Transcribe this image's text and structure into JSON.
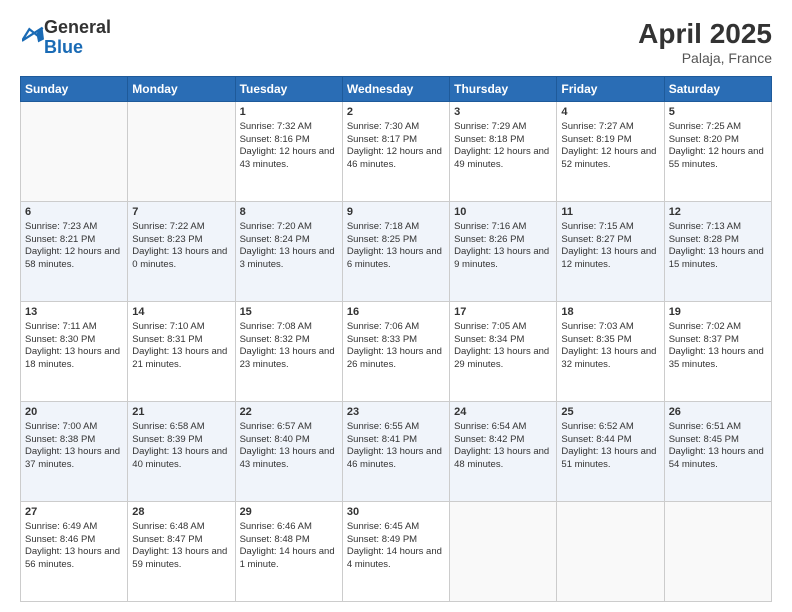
{
  "logo": {
    "general": "General",
    "blue": "Blue"
  },
  "title": {
    "main": "April 2025",
    "sub": "Palaja, France"
  },
  "headers": [
    "Sunday",
    "Monday",
    "Tuesday",
    "Wednesday",
    "Thursday",
    "Friday",
    "Saturday"
  ],
  "weeks": [
    [
      {
        "day": "",
        "info": ""
      },
      {
        "day": "",
        "info": ""
      },
      {
        "day": "1",
        "info": "Sunrise: 7:32 AM\nSunset: 8:16 PM\nDaylight: 12 hours and 43 minutes."
      },
      {
        "day": "2",
        "info": "Sunrise: 7:30 AM\nSunset: 8:17 PM\nDaylight: 12 hours and 46 minutes."
      },
      {
        "day": "3",
        "info": "Sunrise: 7:29 AM\nSunset: 8:18 PM\nDaylight: 12 hours and 49 minutes."
      },
      {
        "day": "4",
        "info": "Sunrise: 7:27 AM\nSunset: 8:19 PM\nDaylight: 12 hours and 52 minutes."
      },
      {
        "day": "5",
        "info": "Sunrise: 7:25 AM\nSunset: 8:20 PM\nDaylight: 12 hours and 55 minutes."
      }
    ],
    [
      {
        "day": "6",
        "info": "Sunrise: 7:23 AM\nSunset: 8:21 PM\nDaylight: 12 hours and 58 minutes."
      },
      {
        "day": "7",
        "info": "Sunrise: 7:22 AM\nSunset: 8:23 PM\nDaylight: 13 hours and 0 minutes."
      },
      {
        "day": "8",
        "info": "Sunrise: 7:20 AM\nSunset: 8:24 PM\nDaylight: 13 hours and 3 minutes."
      },
      {
        "day": "9",
        "info": "Sunrise: 7:18 AM\nSunset: 8:25 PM\nDaylight: 13 hours and 6 minutes."
      },
      {
        "day": "10",
        "info": "Sunrise: 7:16 AM\nSunset: 8:26 PM\nDaylight: 13 hours and 9 minutes."
      },
      {
        "day": "11",
        "info": "Sunrise: 7:15 AM\nSunset: 8:27 PM\nDaylight: 13 hours and 12 minutes."
      },
      {
        "day": "12",
        "info": "Sunrise: 7:13 AM\nSunset: 8:28 PM\nDaylight: 13 hours and 15 minutes."
      }
    ],
    [
      {
        "day": "13",
        "info": "Sunrise: 7:11 AM\nSunset: 8:30 PM\nDaylight: 13 hours and 18 minutes."
      },
      {
        "day": "14",
        "info": "Sunrise: 7:10 AM\nSunset: 8:31 PM\nDaylight: 13 hours and 21 minutes."
      },
      {
        "day": "15",
        "info": "Sunrise: 7:08 AM\nSunset: 8:32 PM\nDaylight: 13 hours and 23 minutes."
      },
      {
        "day": "16",
        "info": "Sunrise: 7:06 AM\nSunset: 8:33 PM\nDaylight: 13 hours and 26 minutes."
      },
      {
        "day": "17",
        "info": "Sunrise: 7:05 AM\nSunset: 8:34 PM\nDaylight: 13 hours and 29 minutes."
      },
      {
        "day": "18",
        "info": "Sunrise: 7:03 AM\nSunset: 8:35 PM\nDaylight: 13 hours and 32 minutes."
      },
      {
        "day": "19",
        "info": "Sunrise: 7:02 AM\nSunset: 8:37 PM\nDaylight: 13 hours and 35 minutes."
      }
    ],
    [
      {
        "day": "20",
        "info": "Sunrise: 7:00 AM\nSunset: 8:38 PM\nDaylight: 13 hours and 37 minutes."
      },
      {
        "day": "21",
        "info": "Sunrise: 6:58 AM\nSunset: 8:39 PM\nDaylight: 13 hours and 40 minutes."
      },
      {
        "day": "22",
        "info": "Sunrise: 6:57 AM\nSunset: 8:40 PM\nDaylight: 13 hours and 43 minutes."
      },
      {
        "day": "23",
        "info": "Sunrise: 6:55 AM\nSunset: 8:41 PM\nDaylight: 13 hours and 46 minutes."
      },
      {
        "day": "24",
        "info": "Sunrise: 6:54 AM\nSunset: 8:42 PM\nDaylight: 13 hours and 48 minutes."
      },
      {
        "day": "25",
        "info": "Sunrise: 6:52 AM\nSunset: 8:44 PM\nDaylight: 13 hours and 51 minutes."
      },
      {
        "day": "26",
        "info": "Sunrise: 6:51 AM\nSunset: 8:45 PM\nDaylight: 13 hours and 54 minutes."
      }
    ],
    [
      {
        "day": "27",
        "info": "Sunrise: 6:49 AM\nSunset: 8:46 PM\nDaylight: 13 hours and 56 minutes."
      },
      {
        "day": "28",
        "info": "Sunrise: 6:48 AM\nSunset: 8:47 PM\nDaylight: 13 hours and 59 minutes."
      },
      {
        "day": "29",
        "info": "Sunrise: 6:46 AM\nSunset: 8:48 PM\nDaylight: 14 hours and 1 minute."
      },
      {
        "day": "30",
        "info": "Sunrise: 6:45 AM\nSunset: 8:49 PM\nDaylight: 14 hours and 4 minutes."
      },
      {
        "day": "",
        "info": ""
      },
      {
        "day": "",
        "info": ""
      },
      {
        "day": "",
        "info": ""
      }
    ]
  ]
}
